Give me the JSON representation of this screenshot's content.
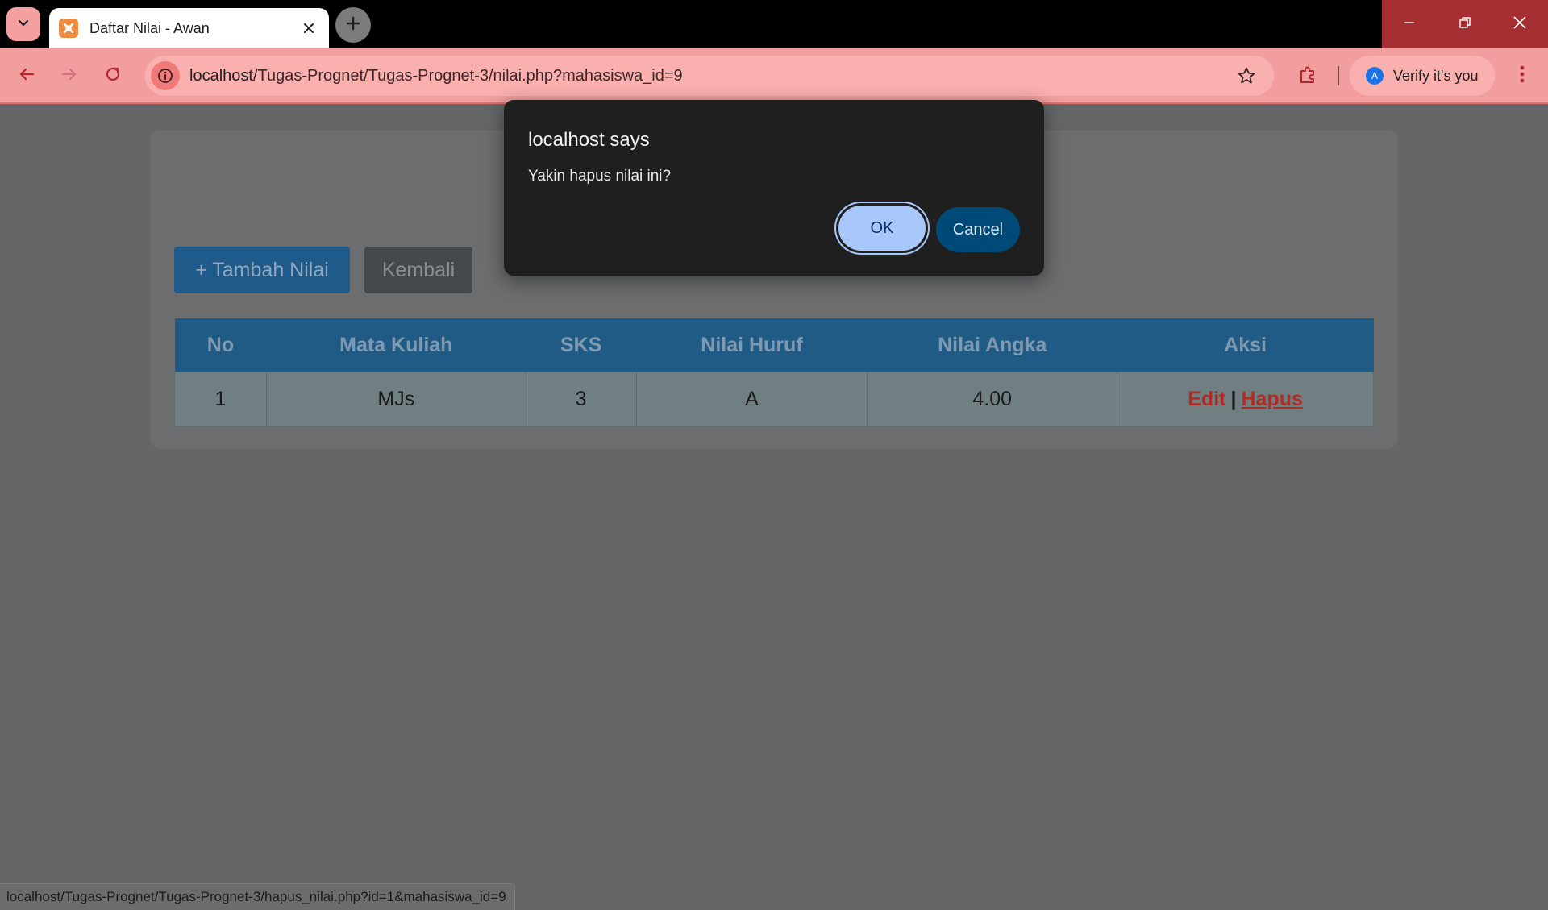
{
  "browser": {
    "tab_title": "Daftar Nilai - Awan",
    "url_host": "localhost",
    "url_path": "/Tugas-Prognet/Tugas-Prognet-3/nilai.php?mahasiswa_id=9",
    "profile_label": "Verify it's you",
    "profile_initial": "A",
    "status_url": "localhost/Tugas-Prognet/Tugas-Prognet-3/hapus_nilai.php?id=1&mahasiswa_id=9"
  },
  "page": {
    "add_button_label": "+ Tambah Nilai",
    "back_button_label": "Kembali",
    "table": {
      "headers": [
        "No",
        "Mata Kuliah",
        "SKS",
        "Nilai Huruf",
        "Nilai Angka",
        "Aksi"
      ],
      "rows": [
        {
          "no": "1",
          "mata_kuliah": "MJs",
          "sks": "3",
          "nilai_huruf": "A",
          "nilai_angka": "4.00",
          "edit_label": "Edit",
          "separator": "|",
          "delete_label": "Hapus"
        }
      ]
    }
  },
  "dialog": {
    "title": "localhost says",
    "message": "Yakin hapus nilai ini?",
    "ok_label": "OK",
    "cancel_label": "Cancel"
  },
  "colors": {
    "theme_accent": "#f29e9e",
    "table_header": "#1f5b85",
    "link_red": "#b52a22"
  }
}
